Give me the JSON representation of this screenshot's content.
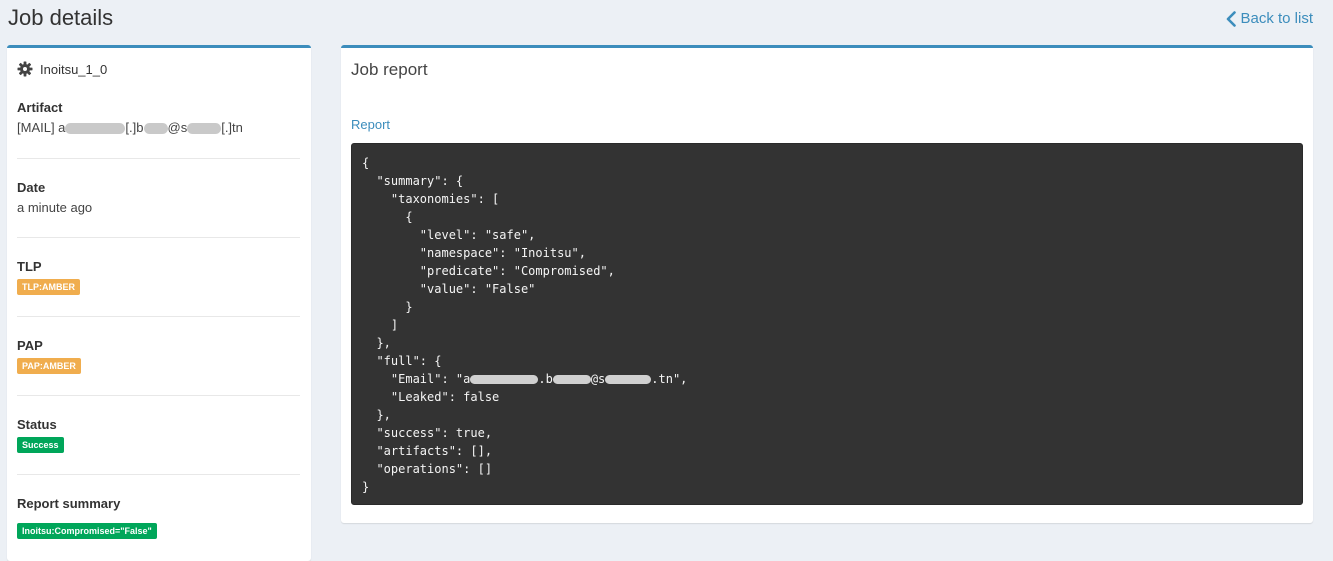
{
  "page": {
    "title": "Job details",
    "back_label": "Back to list"
  },
  "job": {
    "name": "Inoitsu_1_0",
    "artifact_label": "Artifact",
    "artifact_parts": [
      "[MAIL] a",
      "[.]b",
      "@s",
      "[.]tn"
    ],
    "date_label": "Date",
    "date_value": "a minute ago",
    "tlp_label": "TLP",
    "tlp_badge": "TLP:AMBER",
    "pap_label": "PAP",
    "pap_badge": "PAP:AMBER",
    "status_label": "Status",
    "status_badge": "Success",
    "summary_label": "Report summary",
    "summary_badge": "Inoitsu:Compromised=\"False\""
  },
  "report": {
    "title": "Job report",
    "link_label": "Report",
    "lines": [
      "{",
      "  \"summary\": {",
      "    \"taxonomies\": [",
      "      {",
      "        \"level\": \"safe\",",
      "        \"namespace\": \"Inoitsu\",",
      "        \"predicate\": \"Compromised\",",
      "        \"value\": \"False\"",
      "      }",
      "    ]",
      "  },",
      "  \"full\": {",
      "    \"Email\": \"a",
      "    \"Leaked\": false",
      "  },",
      "  \"success\": true,",
      "  \"artifacts\": [],",
      "  \"operations\": []",
      "}"
    ],
    "email_parts": [
      ".b",
      "@s",
      ".tn\","
    ]
  },
  "colors": {
    "accent": "#3c8dbc",
    "amber": "#f0ad4e",
    "success": "#00a65a",
    "code_bg": "#333333"
  },
  "icons": {
    "back": "chevron-left-icon",
    "job": "gear-icon"
  }
}
